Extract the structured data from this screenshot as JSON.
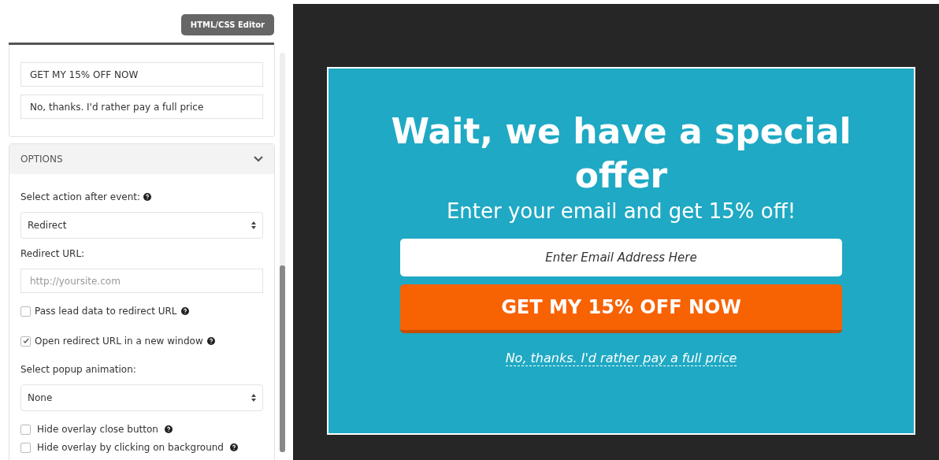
{
  "toolbar": {
    "editor_button": "HTML/CSS Editor"
  },
  "text_fields": [
    {
      "value": "GET MY 15% OFF NOW"
    },
    {
      "value": "No, thanks. I'd rather pay a full price"
    }
  ],
  "options": {
    "title": "OPTIONS",
    "expanded": true,
    "items": [
      {
        "kind": "label",
        "text": "Select action after event:",
        "help": true
      },
      {
        "kind": "select",
        "value": "Redirect"
      },
      {
        "kind": "label",
        "text": "Redirect URL:",
        "help": false
      },
      {
        "kind": "input",
        "placeholder": "http://yoursite.com"
      },
      {
        "kind": "checkbox",
        "label": "Pass lead data to redirect URL",
        "checked": false,
        "help": true,
        "compact": false
      },
      {
        "kind": "checkbox",
        "label": "Open redirect URL in a new window",
        "checked": true,
        "help": true,
        "compact": false
      },
      {
        "kind": "label",
        "text": "Select popup animation:",
        "help": false
      },
      {
        "kind": "select",
        "value": "None"
      },
      {
        "kind": "checkbox",
        "label": "Hide overlay close button",
        "checked": false,
        "help": true,
        "compact": true
      },
      {
        "kind": "checkbox",
        "label": "Hide overlay by clicking on background",
        "checked": false,
        "help": true,
        "compact": true
      }
    ]
  },
  "popup": {
    "heading": "Wait, we have a special offer",
    "subheading": "Enter your email and get 15% off!",
    "email_placeholder": "Enter Email Address Here",
    "cta_button": "GET MY 15% OFF NOW",
    "decline_link": "No, thanks. I'd rather pay a full price"
  }
}
